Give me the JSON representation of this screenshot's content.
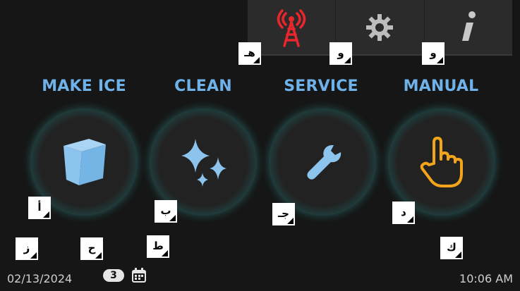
{
  "topbar": {
    "buttons": [
      {
        "icon": "signal-tower-icon",
        "marker": "هـ"
      },
      {
        "icon": "gear-icon",
        "marker": "و"
      },
      {
        "icon": "info-icon",
        "marker": "و"
      }
    ]
  },
  "modes": [
    {
      "label": "MAKE ICE",
      "icon": "ice-cube-icon",
      "marker": "أ"
    },
    {
      "label": "CLEAN",
      "icon": "sparkle-icon",
      "marker": "ب"
    },
    {
      "label": "SERVICE",
      "icon": "wrench-icon",
      "marker": "جـ"
    },
    {
      "label": "MANUAL",
      "icon": "hand-pointer-icon",
      "marker": "د"
    }
  ],
  "markers": {
    "z": "ز",
    "h": "ح",
    "t": "ط",
    "k": "ك"
  },
  "status": {
    "date": "02/13/2024",
    "count": "3",
    "time": "10:06 AM"
  },
  "colors": {
    "accent_label": "#6fb2ea",
    "ring": "#36a7a2",
    "ice": "#8cc4ee",
    "sparkle": "#8cc4ee",
    "wrench": "#8cc4ee",
    "hand": "#f2a51a",
    "tower": "#e8262b"
  }
}
